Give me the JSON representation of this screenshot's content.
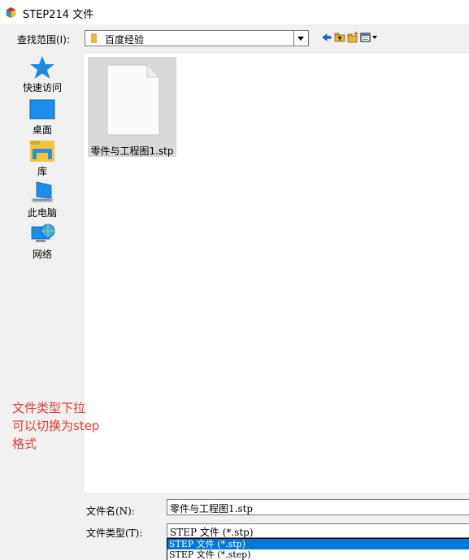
{
  "window": {
    "title": "STEP214 文件"
  },
  "lookin": {
    "label": "查找范围(I):",
    "value": "百度经验"
  },
  "places": [
    {
      "key": "quick-access",
      "label": "快速访问"
    },
    {
      "key": "desktop",
      "label": "桌面"
    },
    {
      "key": "libraries",
      "label": "库"
    },
    {
      "key": "this-pc",
      "label": "此电脑"
    },
    {
      "key": "network",
      "label": "网络"
    }
  ],
  "files": [
    {
      "name": "零件与工程图1.stp"
    }
  ],
  "annotation": {
    "text": "文件类型下拉\n可以切换为step\n格式"
  },
  "filename": {
    "label": "文件名(N):",
    "value": "零件与工程图1.stp"
  },
  "filetype": {
    "label": "文件类型(T):",
    "value": "STEP 文件 (*.stp)",
    "options": [
      "STEP 文件 (*.stp)",
      "STEP 文件 (*.step)"
    ],
    "selected_index": 0
  },
  "colors": {
    "selection": "#0078d7",
    "annotation": "#e53935",
    "folder": "#e7b53a"
  }
}
